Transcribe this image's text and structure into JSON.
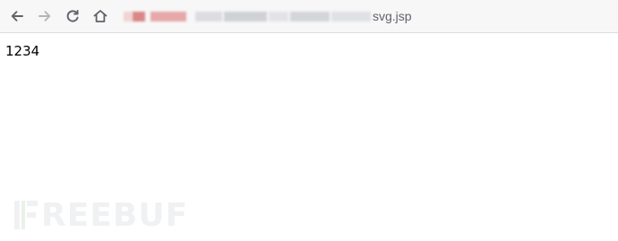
{
  "browser": {
    "address_bar": {
      "visible_url_text": "svg.jsp",
      "obscured": true
    },
    "nav_icons": [
      "back-arrow-icon",
      "forward-arrow-icon",
      "reload-icon",
      "home-icon"
    ]
  },
  "page": {
    "content_text": "1234"
  },
  "watermark": {
    "text": "REEBUF"
  },
  "colors": {
    "toolbar_bg": "#f7f7f8",
    "icon_active": "#5f6368",
    "icon_disabled": "#b3b6ba",
    "redaction_red": "#e3a1a1",
    "redaction_grey": "#d4d6d9",
    "watermark": "#e4e7ea"
  }
}
